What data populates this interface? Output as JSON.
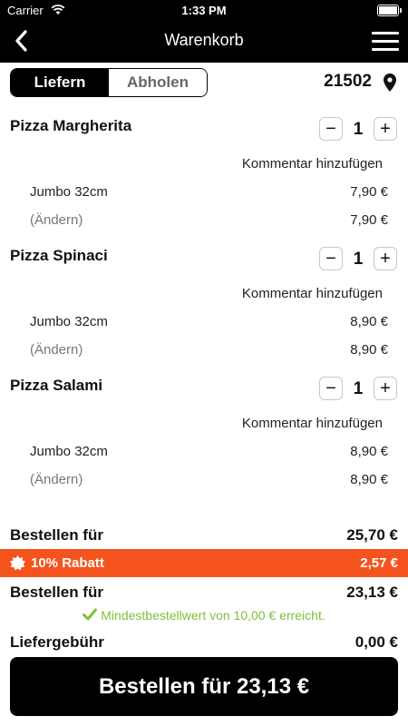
{
  "status_bar": {
    "carrier": "Carrier",
    "time": "1:33 PM"
  },
  "nav": {
    "title": "Warenkorb",
    "back_icon": "chevron-left-icon",
    "menu_icon": "hamburger-menu-icon"
  },
  "delivery_mode": {
    "options": [
      "Liefern",
      "Abholen"
    ],
    "selected": "Liefern"
  },
  "location": {
    "zip": "21502",
    "icon": "map-pin-icon"
  },
  "cart_items": [
    {
      "name": "Pizza Margherita",
      "quantity": "1",
      "comment_label": "Kommentar hinzufügen",
      "size_label": "Jumbo 32cm",
      "size_price": "7,90 €",
      "change_label": "(Ändern)",
      "change_price": "7,90 €"
    },
    {
      "name": "Pizza Spinaci",
      "quantity": "1",
      "comment_label": "Kommentar hinzufügen",
      "size_label": "Jumbo 32cm",
      "size_price": "8,90 €",
      "change_label": "(Ändern)",
      "change_price": "8,90 €"
    },
    {
      "name": "Pizza Salami",
      "quantity": "1",
      "comment_label": "Kommentar hinzufügen",
      "size_label": "Jumbo 32cm",
      "size_price": "8,90 €",
      "change_label": "(Ändern)",
      "change_price": "8,90 €"
    }
  ],
  "stepper": {
    "minus": "−",
    "plus": "+"
  },
  "summary": {
    "subtotal_label": "Bestellen für",
    "subtotal_amount": "25,70 €",
    "discount_label": "10% Rabatt",
    "discount_amount": "2,57 €",
    "total_label": "Bestellen für",
    "total_amount": "23,13 €",
    "min_order_text": "Mindestbestellwert von 10,00 € erreicht.",
    "delivery_fee_label": "Liefergebühr",
    "delivery_fee_amount": "0,00 €"
  },
  "order_button": {
    "label": "Bestellen für 23,13 €"
  },
  "colors": {
    "accent": "#f5531e",
    "success": "#7fbf3a",
    "primary": "#000000"
  }
}
